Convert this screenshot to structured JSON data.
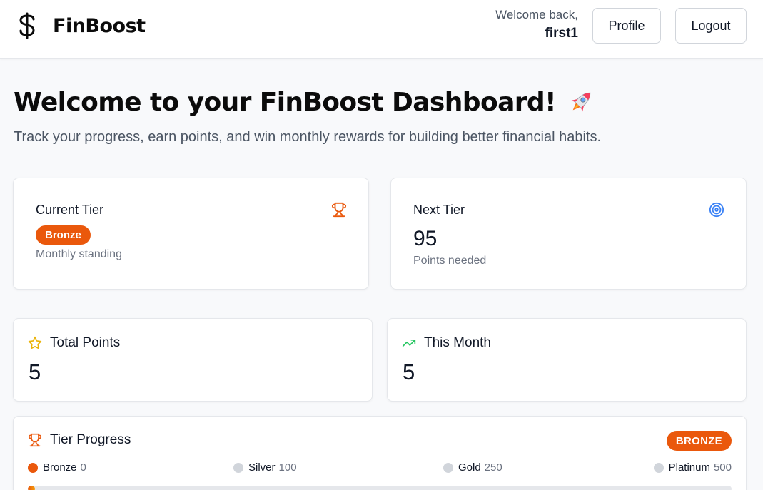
{
  "header": {
    "brand": "FinBoost",
    "logo_icon": "dollar-sign-icon",
    "welcome_text": "Welcome back,",
    "username": "first1",
    "profile_label": "Profile",
    "logout_label": "Logout"
  },
  "main": {
    "title": "Welcome to your FinBoost Dashboard!",
    "title_icon": "rocket-icon",
    "subtitle": "Track your progress, earn points, and win monthly rewards for building better financial habits."
  },
  "current_tier": {
    "label": "Current Tier",
    "icon": "trophy-icon",
    "tier": "Bronze",
    "sub": "Monthly standing"
  },
  "next_tier": {
    "label": "Next Tier",
    "icon": "target-icon",
    "value": "95",
    "sub": "Points needed"
  },
  "total_points": {
    "label": "Total Points",
    "icon": "star-icon",
    "value": "5"
  },
  "this_month": {
    "label": "This Month",
    "icon": "trending-up-icon",
    "value": "5"
  },
  "tier_progress": {
    "label": "Tier Progress",
    "icon": "trophy-icon",
    "badge": "BRONZE",
    "progress_fraction": 0.01,
    "tiers": [
      {
        "name": "Bronze",
        "points": "0",
        "color": "#ea580c"
      },
      {
        "name": "Silver",
        "points": "100",
        "color": "#d1d5db"
      },
      {
        "name": "Gold",
        "points": "250",
        "color": "#d1d5db"
      },
      {
        "name": "Platinum",
        "points": "500",
        "color": "#d1d5db"
      }
    ]
  },
  "colors": {
    "accent": "#ea580c",
    "star": "#eab308",
    "trend": "#22c55e",
    "target": "#3b82f6"
  }
}
